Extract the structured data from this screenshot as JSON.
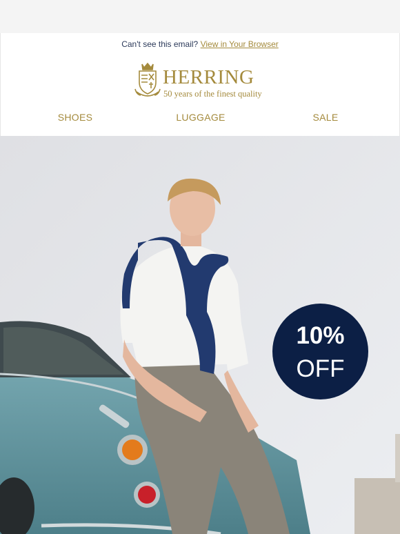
{
  "preheader": {
    "text": "Can't see this email?",
    "link": "View in Your Browser"
  },
  "brand": {
    "name": "HERRING",
    "tagline": "50 years of the finest quality",
    "color": "#a48a3c"
  },
  "nav": [
    {
      "label": "SHOES"
    },
    {
      "label": "LUGGAGE"
    },
    {
      "label": "SALE"
    }
  ],
  "hero": {
    "badge_percent": "10%",
    "badge_off": "OFF",
    "badge_color": "#0c1f45",
    "car_color": "#5a8f9a"
  }
}
